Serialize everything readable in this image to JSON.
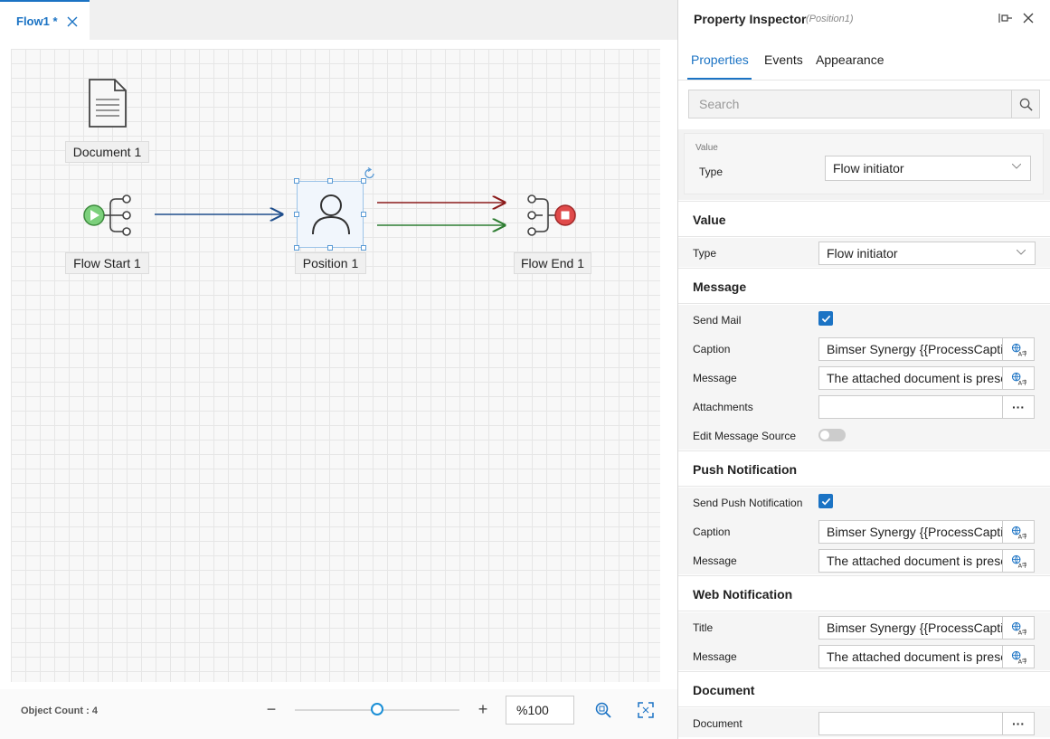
{
  "tab": {
    "label": "Flow1 *"
  },
  "canvas": {
    "document_label": "Document 1",
    "flow_start_label": "Flow Start 1",
    "position_label": "Position 1",
    "flow_end_label": "Flow End 1"
  },
  "footer": {
    "object_count": "Object Count : 4",
    "zoom_minus": "−",
    "zoom_plus": "+",
    "zoom_value": "%100",
    "zoom_level": 0.5
  },
  "inspector": {
    "title": "Property Inspector",
    "subtitle": "(Position1)",
    "tabs": {
      "properties": "Properties",
      "events": "Events",
      "appearance": "Appearance"
    },
    "search_placeholder": "Search",
    "value_card": {
      "legend": "Value",
      "type_label": "Type",
      "type_value": "Flow initiator"
    },
    "value_section": {
      "header": "Value",
      "type_label": "Type",
      "type_value": "Flow initiator"
    },
    "message_section": {
      "header": "Message",
      "send_mail_label": "Send Mail",
      "caption_label": "Caption",
      "caption_value": "Bimser Synergy {{ProcessCaption}}",
      "message_label": "Message",
      "message_value": "The attached document is presented for your approval.",
      "attachments_label": "Attachments",
      "attachments_btn": "···",
      "edit_source_label": "Edit Message Source"
    },
    "push_section": {
      "header": "Push Notification",
      "send_push_label": "Send Push Notification",
      "caption_label": "Caption",
      "caption_value": "Bimser Synergy {{ProcessCaption}}",
      "message_label": "Message",
      "message_value": "The attached document is presented for your approval."
    },
    "web_section": {
      "header": "Web Notification",
      "title_label": "Title",
      "title_value": "Bimser Synergy {{ProcessCaption}}",
      "message_label": "Message",
      "message_value": "The attached document is presented for your approval."
    },
    "document_section": {
      "header": "Document",
      "document_label": "Document",
      "document_btn": "···"
    }
  },
  "colors": {
    "accent": "#1b73c4",
    "arrow_blue": "#1f4e8c",
    "arrow_red": "#8b1a1a",
    "arrow_green": "#2e7d32",
    "start_green": "#7cd07c",
    "end_red": "#e04a4a"
  }
}
